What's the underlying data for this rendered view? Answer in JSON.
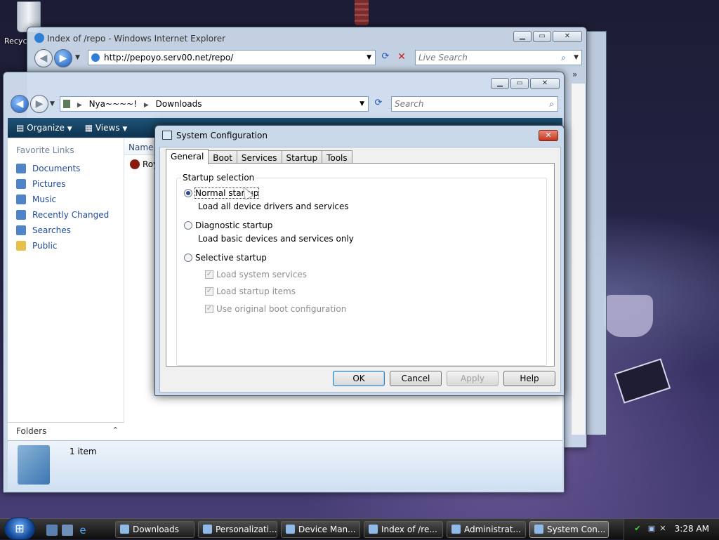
{
  "desktop": {
    "recycle_bin_label": "Recyc"
  },
  "ie": {
    "title": "Index of /repo - Windows Internet Explorer",
    "address": "http://pepoyo.serv00.net/repo/",
    "search_placeholder": "Live Search",
    "chevron": "»"
  },
  "explorer": {
    "breadcrumb": [
      "Nya~~~~!",
      "Downloads"
    ],
    "search_placeholder": "Search",
    "toolbar": {
      "organize": "Organize",
      "views": "Views"
    },
    "favorite_links_header": "Favorite Links",
    "favorite_links": [
      {
        "label": "Documents",
        "icon": "documents-icon"
      },
      {
        "label": "Pictures",
        "icon": "pictures-icon"
      },
      {
        "label": "Music",
        "icon": "music-icon"
      },
      {
        "label": "Recently Changed",
        "icon": "recently-changed-icon"
      },
      {
        "label": "Searches",
        "icon": "searches-icon"
      },
      {
        "label": "Public",
        "icon": "public-folder-icon"
      }
    ],
    "column_name": "Name",
    "file_name": "Roy",
    "folders_label": "Folders",
    "item_count": "1 item"
  },
  "sysconfig": {
    "title": "System Configuration",
    "tabs": [
      "General",
      "Boot",
      "Services",
      "Startup",
      "Tools"
    ],
    "active_tab": "General",
    "group_label": "Startup selection",
    "options": [
      {
        "label": "Normal startup",
        "desc": "Load all device drivers and services",
        "selected": true
      },
      {
        "label": "Diagnostic startup",
        "desc": "Load basic devices and services only",
        "selected": false
      },
      {
        "label": "Selective startup",
        "desc": "",
        "selected": false
      }
    ],
    "selective_items": [
      "Load system services",
      "Load startup items",
      "Use original boot configuration"
    ],
    "buttons": {
      "ok": "OK",
      "cancel": "Cancel",
      "apply": "Apply",
      "help": "Help"
    }
  },
  "taskbar": {
    "tasks": [
      {
        "label": "Downloads",
        "active": false
      },
      {
        "label": "Personalizati...",
        "active": false
      },
      {
        "label": "Device Man...",
        "active": false
      },
      {
        "label": "Index of /re...",
        "active": false
      },
      {
        "label": "Administrat...",
        "active": false
      },
      {
        "label": "System Con...",
        "active": true
      }
    ],
    "clock": "3:28 AM"
  }
}
